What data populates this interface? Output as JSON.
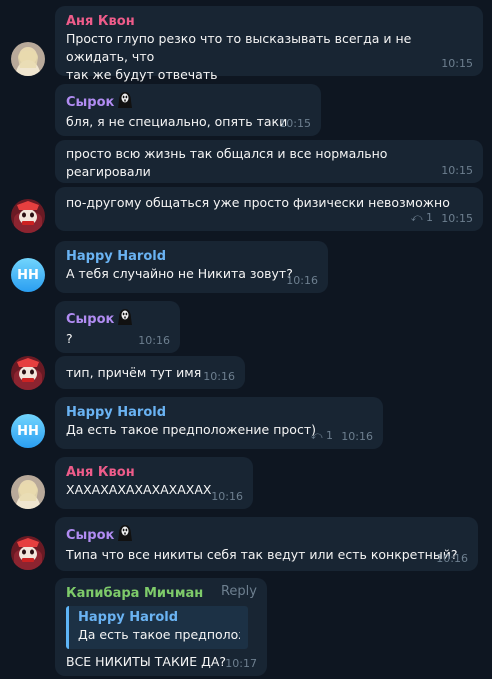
{
  "colors": {
    "background": "#0e1621",
    "bubble": "#182533",
    "name_anya": "#ee5c8a",
    "name_syrok": "#b18cf2",
    "name_harold": "#6ab3f3",
    "name_kapibara": "#7ecb6a",
    "meta": "#6d7f8f"
  },
  "messages": [
    {
      "sender": "Аня Квон",
      "text1": "Просто глупо резко что то высказывать всегда и не ожидать, что",
      "text2": "так же будут отвечать",
      "time": "10:15"
    },
    {
      "sender": "Сырок",
      "text": "бля, я не специально, опять таки",
      "time": "10:15"
    },
    {
      "text": "просто всю жизнь так общался и все нормально реагировали",
      "time": "10:15"
    },
    {
      "text": "по-другому общаться уже просто физически невозможно",
      "replies": "1",
      "time": "10:15"
    },
    {
      "sender": "Happy Harold",
      "text": "А тебя случайно не Никита зовут?",
      "time": "10:16"
    },
    {
      "sender": "Сырок",
      "text": "?",
      "time": "10:16"
    },
    {
      "text": "тип, причём тут имя",
      "time": "10:16"
    },
    {
      "sender": "Happy Harold",
      "text": "Да есть такое предположение прост)",
      "replies": "1",
      "time": "10:16"
    },
    {
      "sender": "Аня Квон",
      "text": "ХАХАХАХАХАХАХАХАХ",
      "time": "10:16"
    },
    {
      "sender": "Сырок",
      "text": "Типа что все никиты себя так ведут или есть конкретный?",
      "time": "10:16"
    },
    {
      "sender": "Капибара Мичман",
      "reply_label": "Reply",
      "quote_name": "Happy Harold",
      "quote_text": "Да есть такое предположе...",
      "text": "ВСЕ НИКИТЫ ТАКИЕ ДА?",
      "time": "10:17"
    }
  ],
  "avatars": {
    "harold_initials": "HH"
  }
}
